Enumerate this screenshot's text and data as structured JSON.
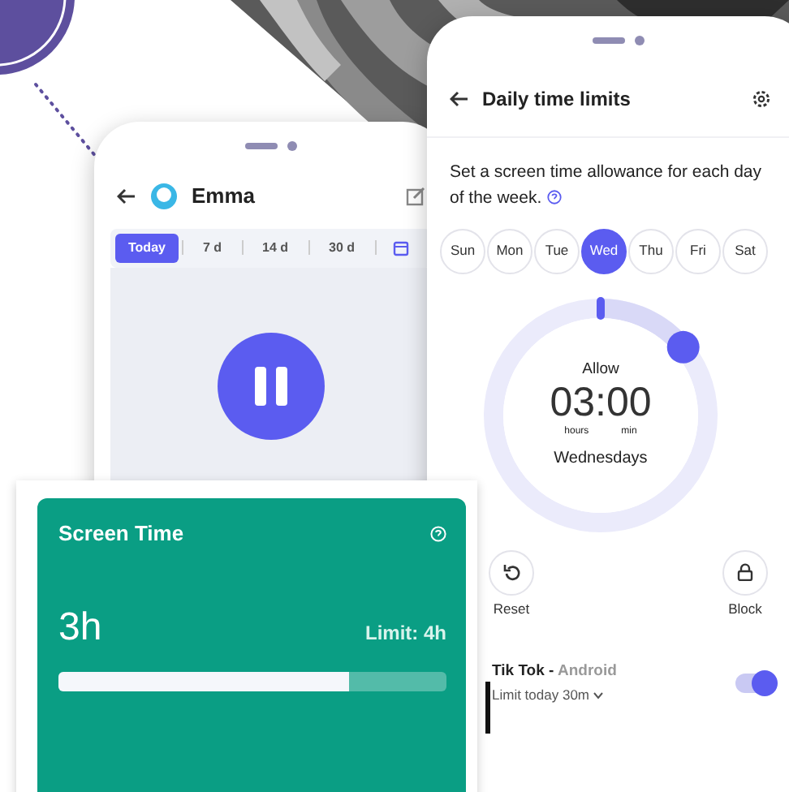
{
  "left_phone": {
    "title": "Emma",
    "range_tabs": [
      {
        "label": "Today",
        "selected": true
      },
      {
        "label": "7 d",
        "selected": false
      },
      {
        "label": "14 d",
        "selected": false
      },
      {
        "label": "30 d",
        "selected": false
      }
    ]
  },
  "right_phone": {
    "title": "Daily time limits",
    "description": "Set a screen time allowance for each day of the week.",
    "days": [
      {
        "label": "Sun",
        "selected": false
      },
      {
        "label": "Mon",
        "selected": false
      },
      {
        "label": "Tue",
        "selected": false
      },
      {
        "label": "Wed",
        "selected": true
      },
      {
        "label": "Thu",
        "selected": false
      },
      {
        "label": "Fri",
        "selected": false
      },
      {
        "label": "Sat",
        "selected": false
      }
    ],
    "dial": {
      "caption": "Allow",
      "time": "03:00",
      "hours_label": "hours",
      "minutes_label": "min",
      "day": "Wednesdays",
      "level": 0.14
    },
    "actions": [
      {
        "kind": "reset",
        "label": "Reset"
      },
      {
        "kind": "block",
        "label": "Block"
      }
    ],
    "app_row": {
      "name": "Tik Tok -",
      "platform": "Android",
      "limit": "Limit today 30m",
      "on": true
    }
  },
  "screen_time_card": {
    "title": "Screen Time",
    "value": "3h",
    "limit": "Limit: 4h",
    "level": 0.75
  }
}
